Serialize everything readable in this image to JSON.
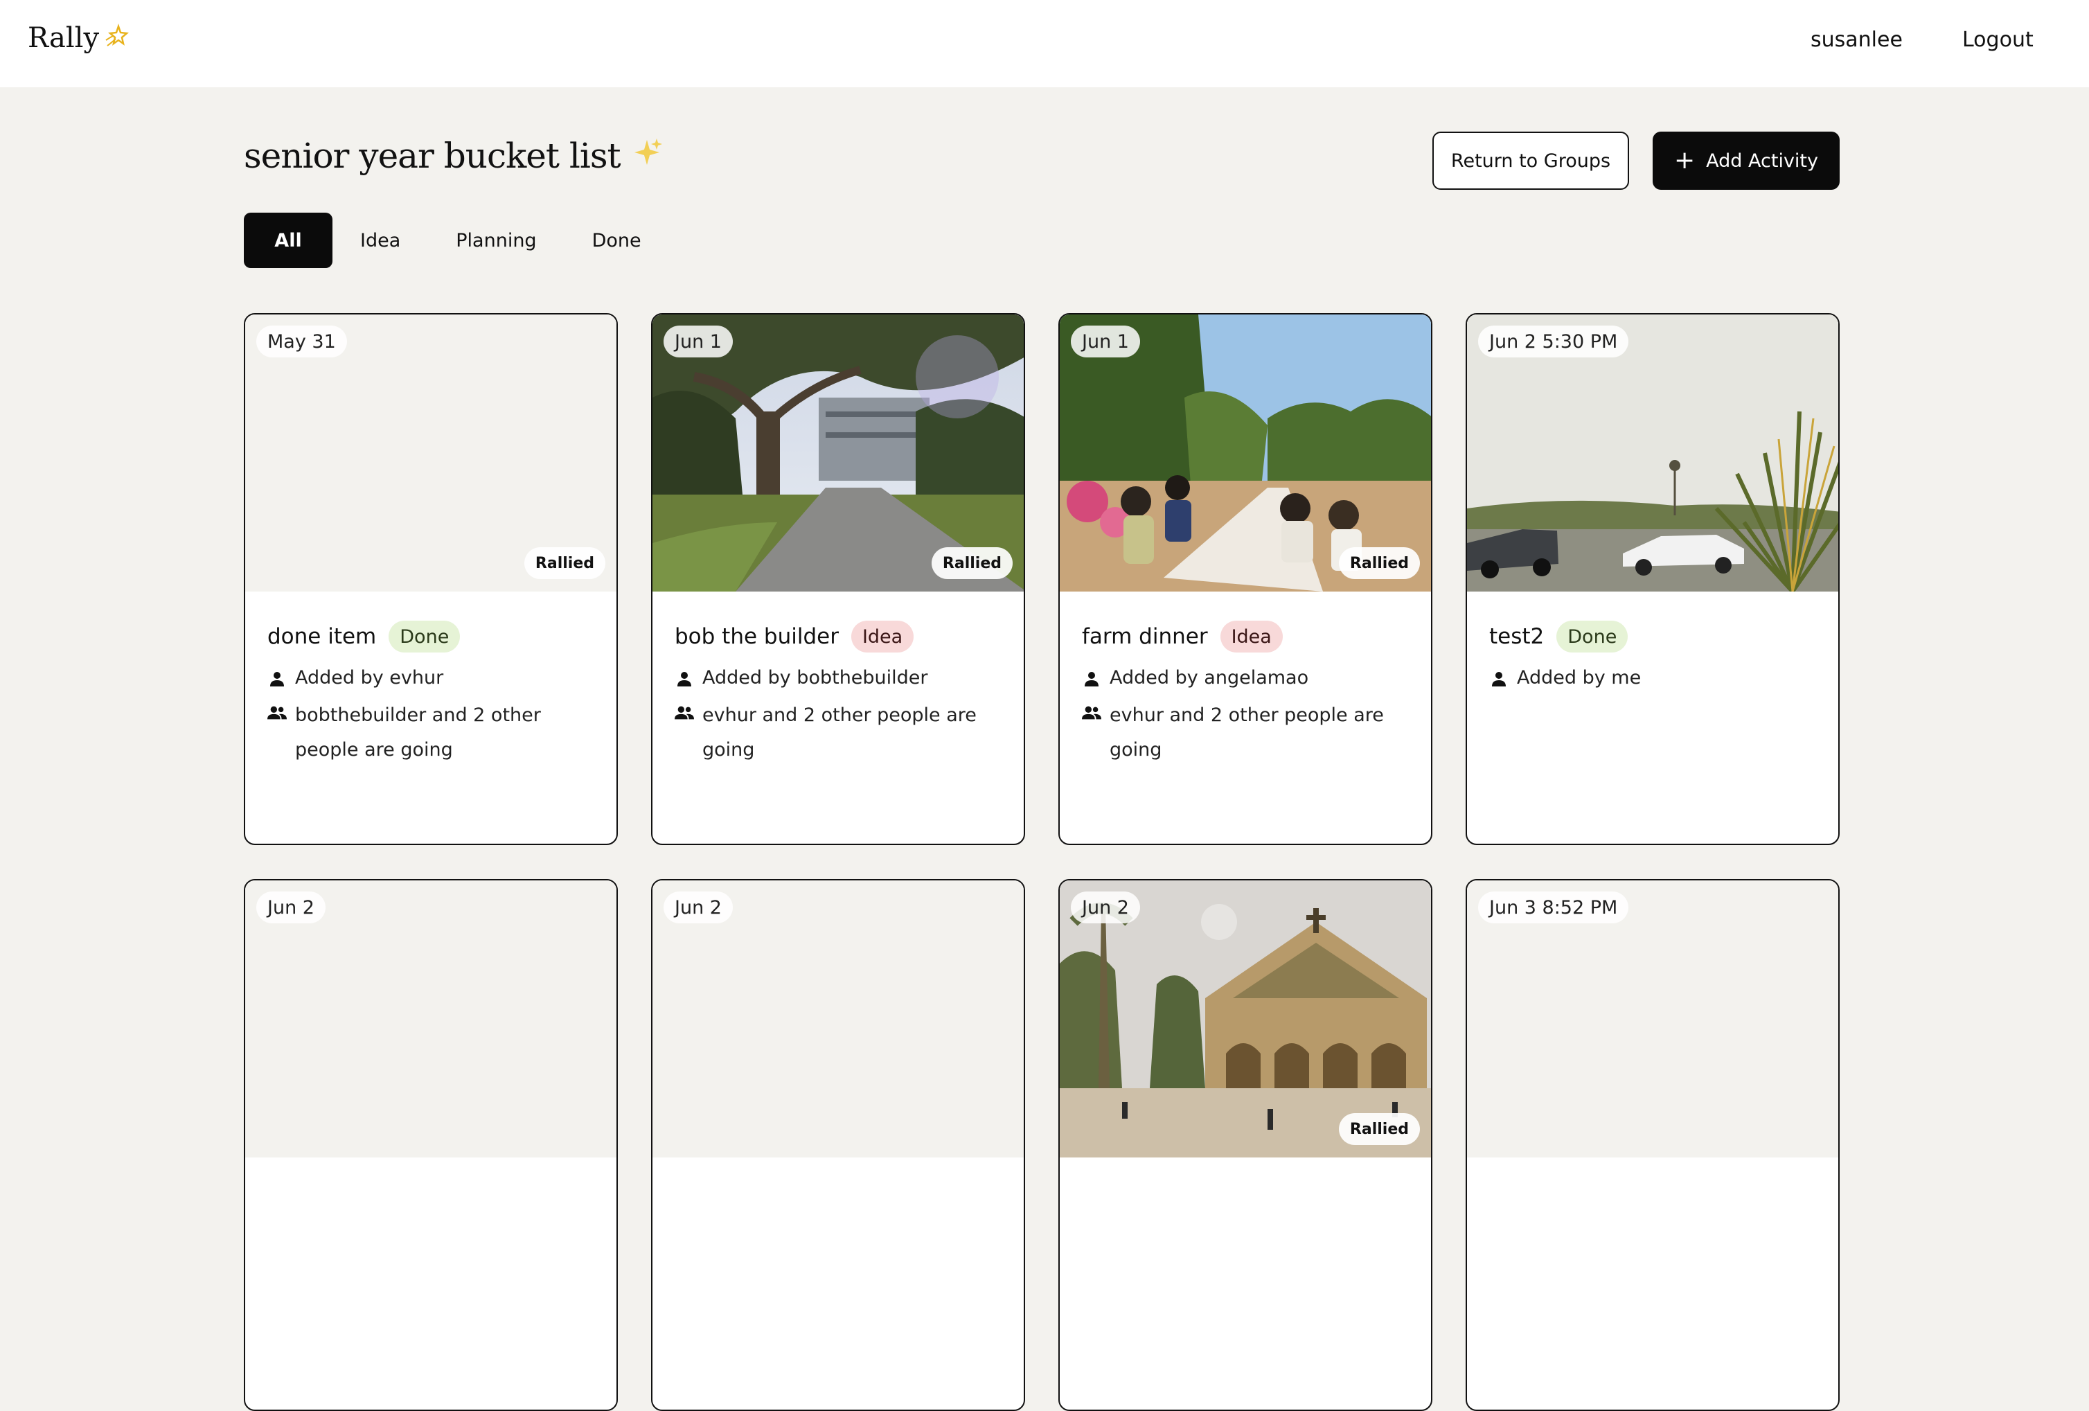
{
  "nav": {
    "brand": "Rally",
    "brand_icon": "shooting-star-icon",
    "username": "susanlee",
    "logout": "Logout"
  },
  "header": {
    "title": "senior year bucket list",
    "title_icon": "sparkles-icon",
    "return_button": "Return to Groups",
    "add_button": "Add Activity"
  },
  "tabs": [
    {
      "label": "All",
      "active": true
    },
    {
      "label": "Idea",
      "active": false
    },
    {
      "label": "Planning",
      "active": false
    },
    {
      "label": "Done",
      "active": false
    }
  ],
  "colors": {
    "background": "#f3f2ee",
    "primary": "#0b0b0b",
    "done_badge_bg": "#e6f3d6",
    "idea_badge_bg": "#f8d9d9"
  },
  "cards": [
    {
      "date": "May 31",
      "rallied": "Rallied",
      "title": "done item",
      "status": "Done",
      "added_by": "Added by evhur",
      "going": "bobthebuilder and 2 other people are going"
    },
    {
      "date": "Jun 1",
      "rallied": "Rallied",
      "title": "bob the builder",
      "status": "Idea",
      "added_by": "Added by bobthebuilder",
      "going": "evhur and 2 other people are going"
    },
    {
      "date": "Jun 1",
      "rallied": "Rallied",
      "title": "farm dinner",
      "status": "Idea",
      "added_by": "Added by angelamao",
      "going": "evhur and 2 other people are going"
    },
    {
      "date": "Jun 2 5:30 PM",
      "title": "test2",
      "status": "Done",
      "added_by": "Added by me"
    },
    {
      "date": "Jun 2"
    },
    {
      "date": "Jun 2"
    },
    {
      "date": "Jun 2",
      "rallied": "Rallied"
    },
    {
      "date": "Jun 3 8:52 PM"
    }
  ]
}
